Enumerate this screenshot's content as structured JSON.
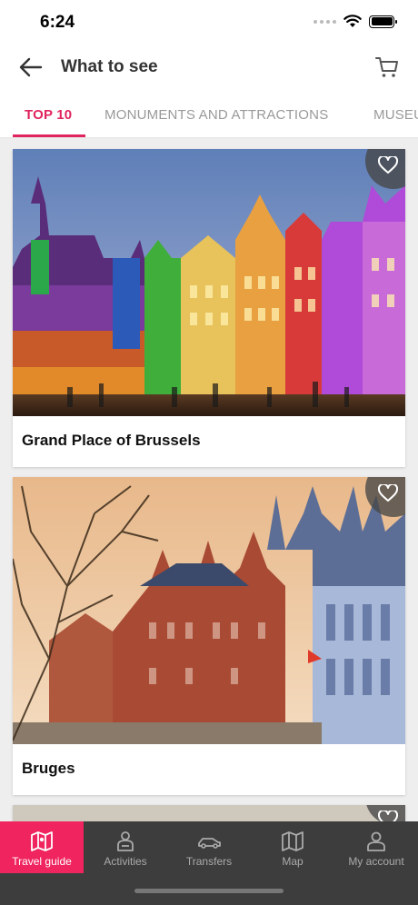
{
  "status_bar": {
    "time": "6:24"
  },
  "header": {
    "title": "What to see"
  },
  "tabs": [
    {
      "label": "TOP 10",
      "active": true
    },
    {
      "label": "MONUMENTS AND ATTRACTIONS",
      "active": false
    },
    {
      "label": "MUSEU",
      "active": false
    }
  ],
  "cards": [
    {
      "title": "Grand Place of Brussels"
    },
    {
      "title": "Bruges"
    }
  ],
  "tabbar": {
    "items": [
      {
        "label": "Travel guide",
        "icon": "map-book-icon",
        "active": true
      },
      {
        "label": "Activities",
        "icon": "person-activity-icon",
        "active": false
      },
      {
        "label": "Transfers",
        "icon": "car-transfer-icon",
        "active": false
      },
      {
        "label": "Map",
        "icon": "folded-map-icon",
        "active": false
      },
      {
        "label": "My account",
        "icon": "user-icon",
        "active": false
      }
    ]
  },
  "colors": {
    "accent": "#e0245e",
    "tabbar_bg": "#3d3d3d",
    "tabbar_active": "#f0245e"
  }
}
